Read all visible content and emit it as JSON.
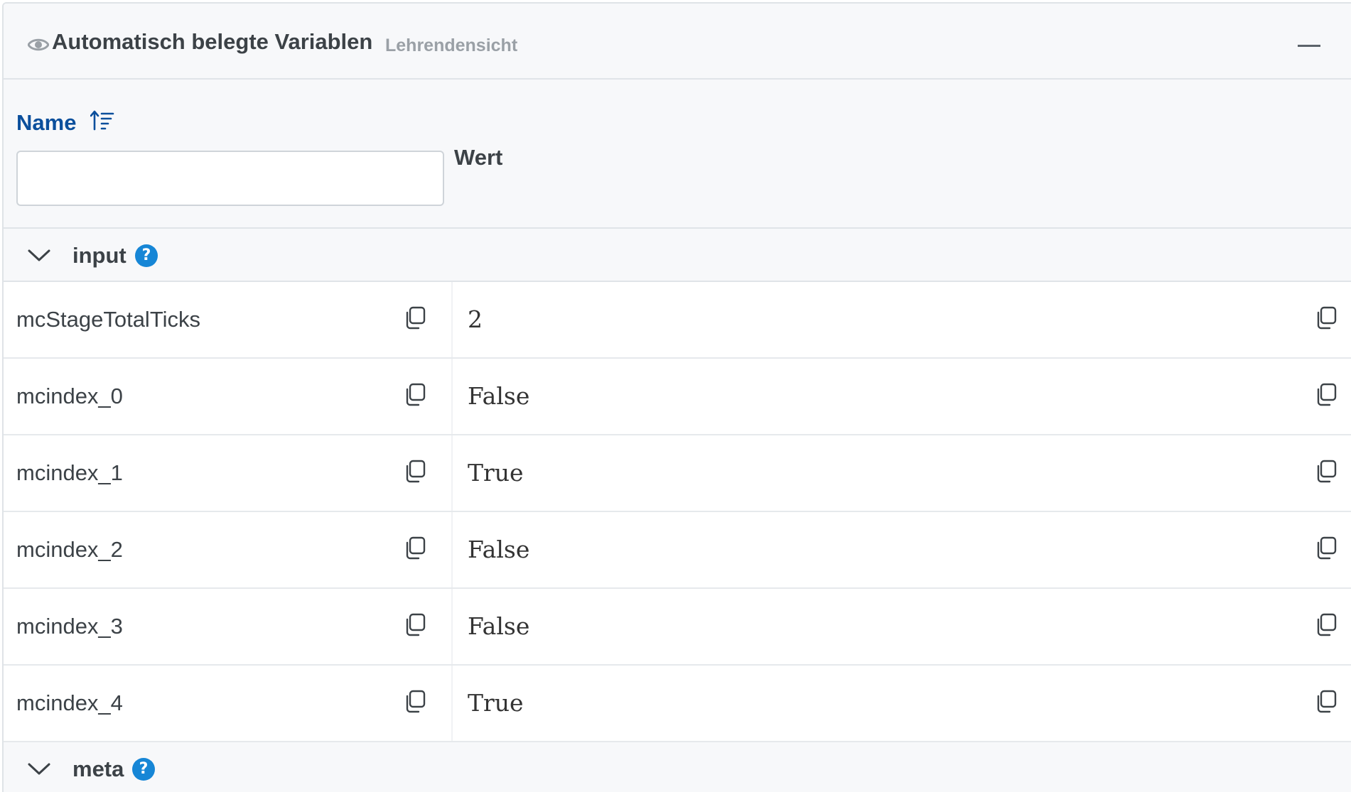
{
  "header": {
    "title": "Automatisch belegte Variablen",
    "subtitle": "Lehrendensicht",
    "icon": "eye-icon",
    "collapse_icon": "minus-icon"
  },
  "columns": {
    "name_label": "Name",
    "value_label": "Wert",
    "filter_value": ""
  },
  "groups": [
    {
      "label": "input",
      "help_symbol": "?",
      "rows": [
        {
          "name": "mcStageTotalTicks",
          "value": "2"
        },
        {
          "name": "mcindex_0",
          "value": "False"
        },
        {
          "name": "mcindex_1",
          "value": "True"
        },
        {
          "name": "mcindex_2",
          "value": "False"
        },
        {
          "name": "mcindex_3",
          "value": "False"
        },
        {
          "name": "mcindex_4",
          "value": "True"
        }
      ]
    },
    {
      "label": "meta",
      "help_symbol": "?",
      "rows": []
    }
  ],
  "colors": {
    "accent": "#0b4f9c",
    "help_badge": "#1686d6",
    "header_bg": "#f7f8fa"
  }
}
